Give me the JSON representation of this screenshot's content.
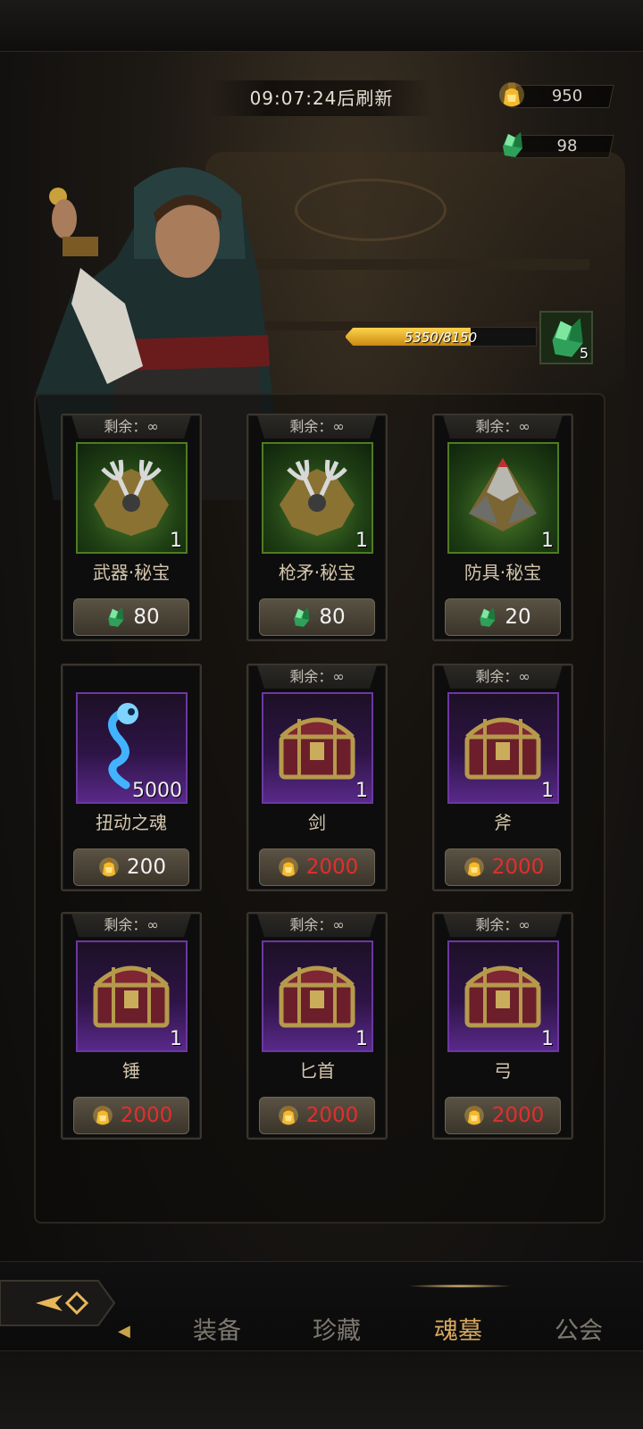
{
  "timer": {
    "text": "09:07:24后刷新"
  },
  "currency": {
    "gold": {
      "icon": "soul-bottle-icon",
      "value": "950"
    },
    "gem": {
      "icon": "green-crystal-icon",
      "value": "98"
    }
  },
  "progress": {
    "text": "5350/8150",
    "current": 5350,
    "max": 8150
  },
  "gem_slot": {
    "icon": "green-crystal-icon",
    "count": "5"
  },
  "shop_items": [
    {
      "remain": "剩余：∞",
      "name": "武器·秘宝",
      "qty": "1",
      "rarity": "green",
      "icon": "weapon-treasure-icon",
      "currency_icon": "green-crystal-icon",
      "price": "80",
      "affordable": true
    },
    {
      "remain": "剩余：∞",
      "name": "枪矛·秘宝",
      "qty": "1",
      "rarity": "green",
      "icon": "spear-treasure-icon",
      "currency_icon": "green-crystal-icon",
      "price": "80",
      "affordable": true
    },
    {
      "remain": "剩余：∞",
      "name": "防具·秘宝",
      "qty": "1",
      "rarity": "green",
      "icon": "armor-treasure-icon",
      "currency_icon": "green-crystal-icon",
      "price": "20",
      "affordable": true
    },
    {
      "remain": "",
      "name": "扭动之魂",
      "qty": "5000",
      "rarity": "purple",
      "icon": "wisp-soul-icon",
      "currency_icon": "soul-bottle-icon",
      "price": "200",
      "affordable": true
    },
    {
      "remain": "剩余：∞",
      "name": "剑",
      "qty": "1",
      "rarity": "purple",
      "icon": "chest-icon",
      "currency_icon": "soul-bottle-icon",
      "price": "2000",
      "affordable": false
    },
    {
      "remain": "剩余：∞",
      "name": "斧",
      "qty": "1",
      "rarity": "purple",
      "icon": "chest-icon",
      "currency_icon": "soul-bottle-icon",
      "price": "2000",
      "affordable": false
    },
    {
      "remain": "剩余：∞",
      "name": "锤",
      "qty": "1",
      "rarity": "purple",
      "icon": "chest-icon",
      "currency_icon": "soul-bottle-icon",
      "price": "2000",
      "affordable": false
    },
    {
      "remain": "剩余：∞",
      "name": "匕首",
      "qty": "1",
      "rarity": "purple",
      "icon": "chest-icon",
      "currency_icon": "soul-bottle-icon",
      "price": "2000",
      "affordable": false
    },
    {
      "remain": "剩余：∞",
      "name": "弓",
      "qty": "1",
      "rarity": "purple",
      "icon": "chest-icon",
      "currency_icon": "soul-bottle-icon",
      "price": "2000",
      "affordable": false
    }
  ],
  "nav": {
    "back_icon": "back-arrow-icon",
    "tabs": [
      {
        "label": "装备",
        "active": false
      },
      {
        "label": "珍藏",
        "active": false
      },
      {
        "label": "魂墓",
        "active": true
      },
      {
        "label": "公会",
        "active": false
      }
    ]
  },
  "colors": {
    "price_short": "#e52d2d",
    "active_tab": "#d9a85f",
    "progress_fill": "#ffd34a"
  }
}
